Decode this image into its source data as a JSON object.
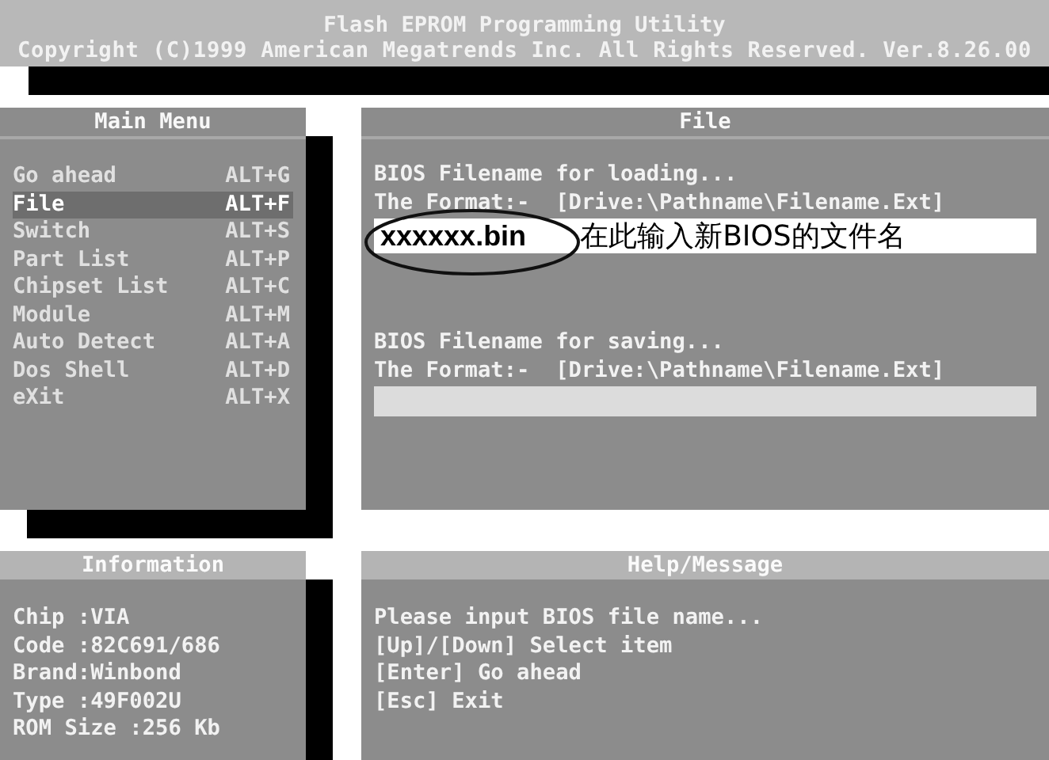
{
  "header": {
    "title": "Flash EPROM Programming Utility",
    "copyright": "Copyright (C)1999 American Megatrends Inc. All Rights Reserved. Ver.8.26.00"
  },
  "main_menu": {
    "title": "Main Menu",
    "items": [
      {
        "label": "Go ahead",
        "shortcut": "ALT+G",
        "selected": false
      },
      {
        "label": "File",
        "shortcut": "ALT+F",
        "selected": true
      },
      {
        "label": "Switch",
        "shortcut": "ALT+S",
        "selected": false
      },
      {
        "label": "Part List",
        "shortcut": "ALT+P",
        "selected": false
      },
      {
        "label": "Chipset List",
        "shortcut": "ALT+C",
        "selected": false
      },
      {
        "label": "Module",
        "shortcut": "ALT+M",
        "selected": false
      },
      {
        "label": "Auto Detect",
        "shortcut": "ALT+A",
        "selected": false
      },
      {
        "label": "Dos Shell",
        "shortcut": "ALT+D",
        "selected": false
      },
      {
        "label": "eXit",
        "shortcut": "ALT+X",
        "selected": false
      }
    ]
  },
  "file_panel": {
    "title": "File",
    "sections": [
      {
        "heading": "BIOS Filename for loading...",
        "format": "The Format:-  [Drive:\\Pathname\\Filename.Ext]",
        "field": {
          "value": "xxxxxx.bin",
          "focused": true
        },
        "annotation": "在此输入新BIOS的文件名"
      },
      {
        "heading": "BIOS Filename for saving...",
        "format": "The Format:-  [Drive:\\Pathname\\Filename.Ext]",
        "field": {
          "focused": false
        }
      }
    ]
  },
  "information": {
    "title": "Information",
    "lines": [
      "Chip :VIA",
      "Code :82C691/686",
      "Brand:Winbond",
      "Type :49F002U",
      "ROM Size :256 Kb"
    ]
  },
  "help": {
    "title": "Help/Message",
    "lines": [
      "Please input BIOS file name...",
      "[Up]/[Down] Select item",
      "[Enter] Go ahead",
      "[Esc] Exit"
    ]
  }
}
